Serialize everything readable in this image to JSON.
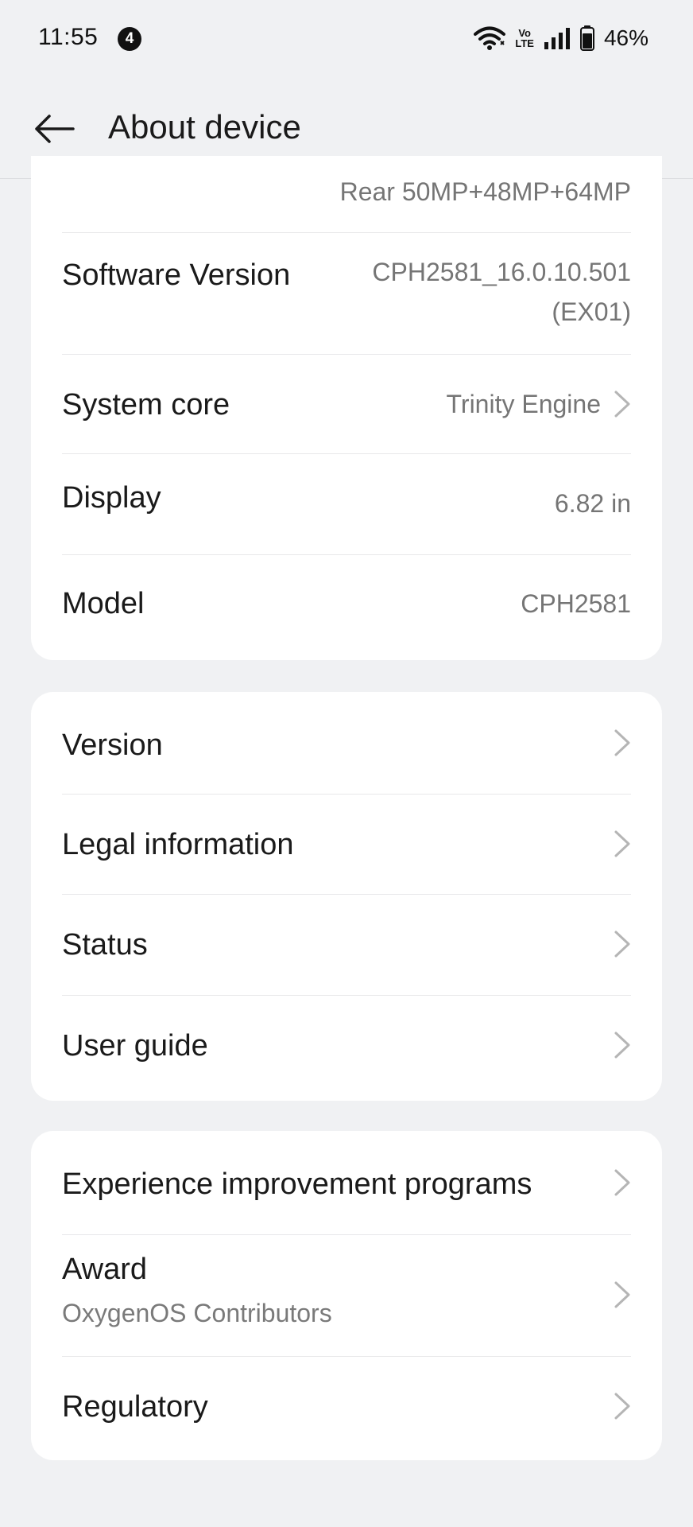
{
  "status_bar": {
    "time": "11:55",
    "notification_count": "4",
    "volte_top": "Vo",
    "volte_bottom": "LTE",
    "battery": "46%"
  },
  "header": {
    "title": "About device"
  },
  "card1": {
    "camera_value": "Rear 50MP+48MP+64MP",
    "software_label": "Software Version",
    "software_value_line1": "CPH2581_16.0.10.501",
    "software_value_line2": "(EX01)",
    "system_core_label": "System core",
    "system_core_value": "Trinity Engine",
    "display_label": "Display",
    "display_value": "6.82 in",
    "model_label": "Model",
    "model_value": "CPH2581"
  },
  "card2": {
    "items": [
      "Version",
      "Legal information",
      "Status",
      "User guide"
    ]
  },
  "card3": {
    "experience_label": "Experience improvement programs",
    "award_label": "Award",
    "award_sub": "OxygenOS Contributors",
    "regulatory_label": "Regulatory"
  },
  "colors": {
    "background": "#f0f1f3",
    "card": "#ffffff",
    "primary_text": "#1a1a1a",
    "secondary_text": "#757575"
  }
}
